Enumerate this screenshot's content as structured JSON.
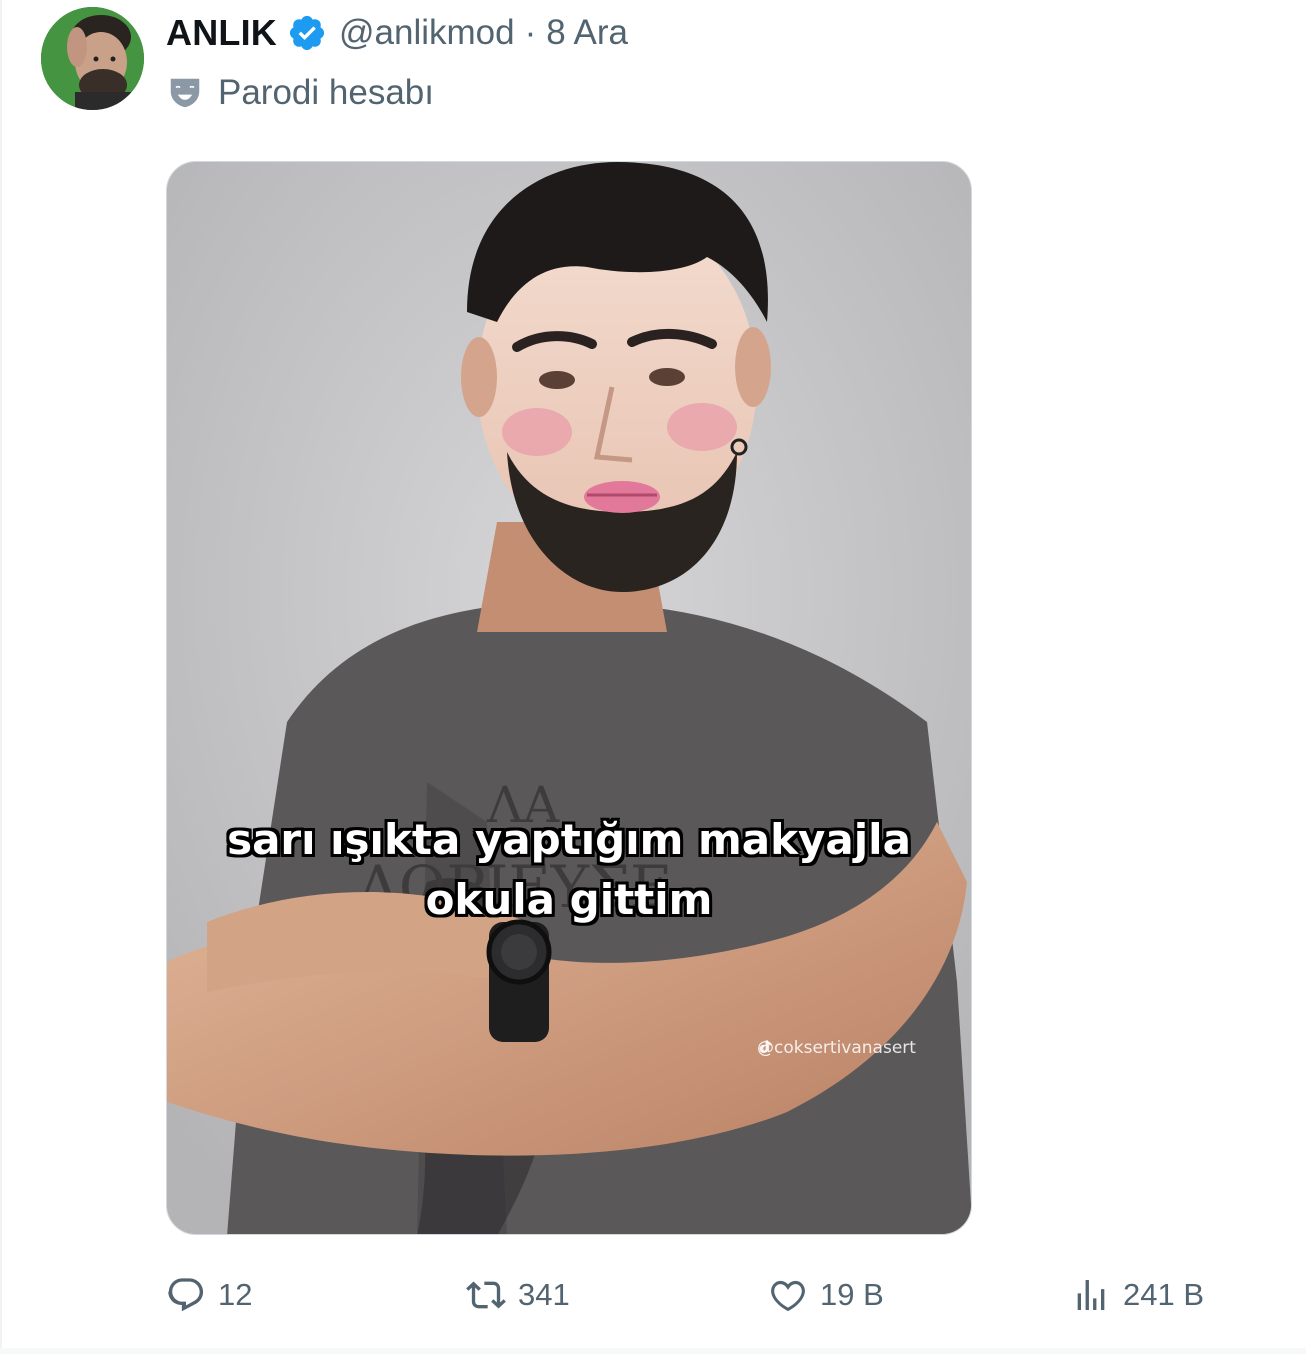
{
  "author": {
    "display_name": "ANLIK",
    "handle": "@anlikmod",
    "separator": "·",
    "date": "8 Ara",
    "parody_label": "Parodi hesabı",
    "verified_color": "#1d9bf0"
  },
  "media": {
    "caption": "sarı ışıkta yaptığım makyajla\nokula gittim",
    "watermark": "@coksertivanasert",
    "shirt_text_line1": "ΛΑ",
    "shirt_text_line2": "ΛΟΡΙΕΥΣΕ"
  },
  "actions": {
    "replies": "12",
    "reposts": "341",
    "likes": "19 B",
    "views": "241 B"
  },
  "icons": {
    "verified": "verified-badge-icon",
    "parody": "parody-mask-icon",
    "reply": "reply-icon",
    "repost": "repost-icon",
    "like": "heart-icon",
    "views": "views-chart-icon"
  },
  "colors": {
    "text_primary": "#0f1419",
    "text_secondary": "#536471",
    "accent": "#1d9bf0"
  }
}
